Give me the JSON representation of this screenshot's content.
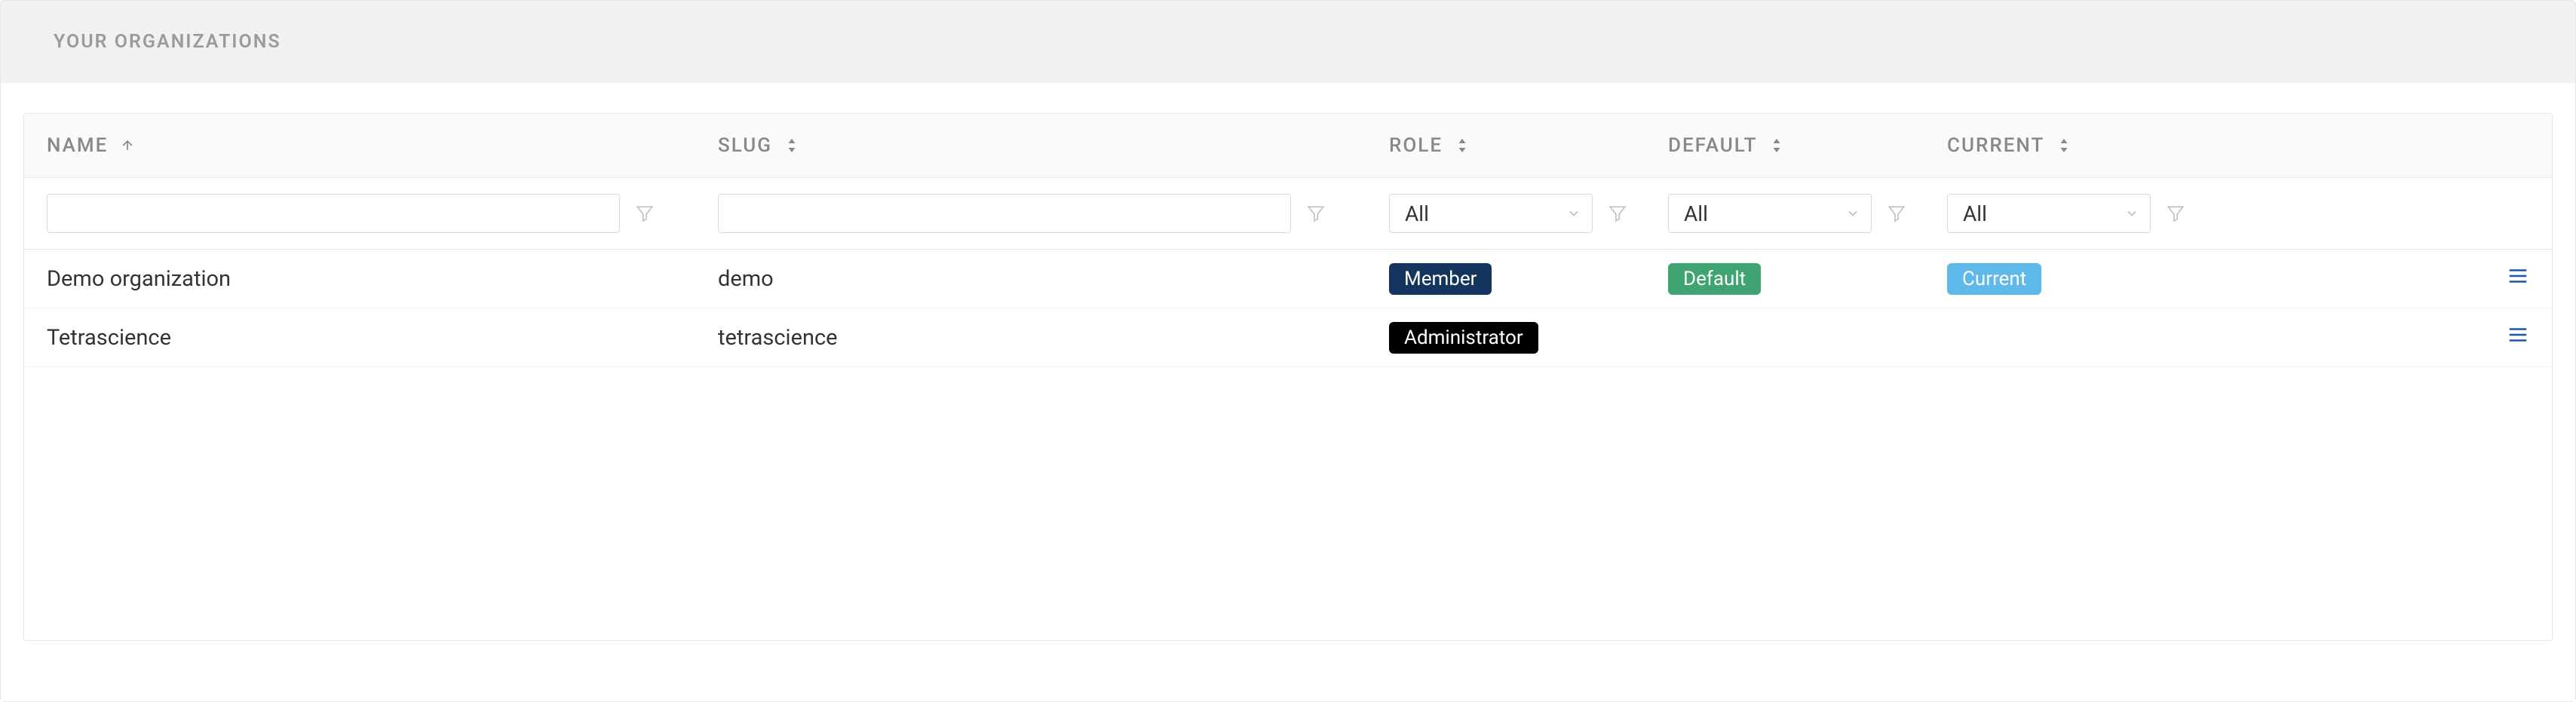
{
  "panel": {
    "title": "YOUR ORGANIZATIONS"
  },
  "columns": {
    "name": "NAME",
    "slug": "SLUG",
    "role": "ROLE",
    "default": "DEFAULT",
    "current": "CURRENT"
  },
  "filters": {
    "name_value": "",
    "slug_value": "",
    "role_selected": "All",
    "default_selected": "All",
    "current_selected": "All"
  },
  "rows": [
    {
      "name": "Demo organization",
      "slug": "demo",
      "role": "Member",
      "role_style": "member",
      "default": "Default",
      "current": "Current"
    },
    {
      "name": "Tetrascience",
      "slug": "tetrascience",
      "role": "Administrator",
      "role_style": "admin",
      "default": "",
      "current": ""
    }
  ]
}
